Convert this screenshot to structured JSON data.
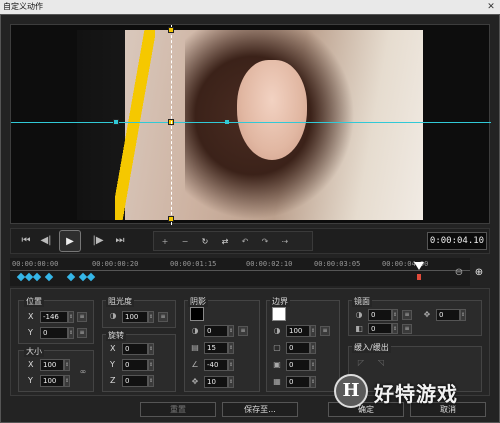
{
  "window": {
    "title": "自定义动作",
    "close_glyph": "✕"
  },
  "transport": {
    "timecode": "0:00:04.10",
    "buttons": [
      "⏮",
      "◀|",
      "▶",
      "|▶",
      "⏭"
    ]
  },
  "timeline": {
    "ticks": [
      "00:00:00:00",
      "00:00:00:20",
      "00:00:01:15",
      "00:00:02:10",
      "00:00:03:05",
      "00:00:04:00"
    ]
  },
  "position": {
    "label": "位置",
    "x_label": "X",
    "x_value": "-146",
    "y_label": "Y",
    "y_value": "0"
  },
  "size": {
    "label": "大小",
    "x_label": "X",
    "x_value": "100",
    "y_label": "Y",
    "y_value": "100"
  },
  "opacity": {
    "label": "阻光度",
    "value": "100"
  },
  "rotation": {
    "label": "旋转",
    "x_label": "X",
    "x_value": "0",
    "y_label": "Y",
    "y_value": "0",
    "z_label": "Z",
    "z_value": "0"
  },
  "shadow": {
    "label": "阴影",
    "color": "#000000",
    "opacity": "0",
    "blur": "15",
    "angle": "-40",
    "distance": "10"
  },
  "border": {
    "label": "边界",
    "color": "#ffffff",
    "opacity": "100",
    "v1": "0",
    "v2": "0",
    "v3": "0"
  },
  "mirror": {
    "label": "镜面",
    "opacity": "0",
    "distance": "0",
    "offset": "0"
  },
  "fade": {
    "label": "缓入/缓出"
  },
  "actions": {
    "reset": "重置",
    "save_as": "保存至...",
    "ok": "确定",
    "cancel": "取消"
  },
  "watermark": {
    "text": "好特游戏",
    "logo": "H"
  },
  "colors": {
    "accent_cyan": "#31c9d6",
    "keyframe": "#35b6e8",
    "yellow": "#f5c800",
    "playhead": "#e04a3a"
  }
}
